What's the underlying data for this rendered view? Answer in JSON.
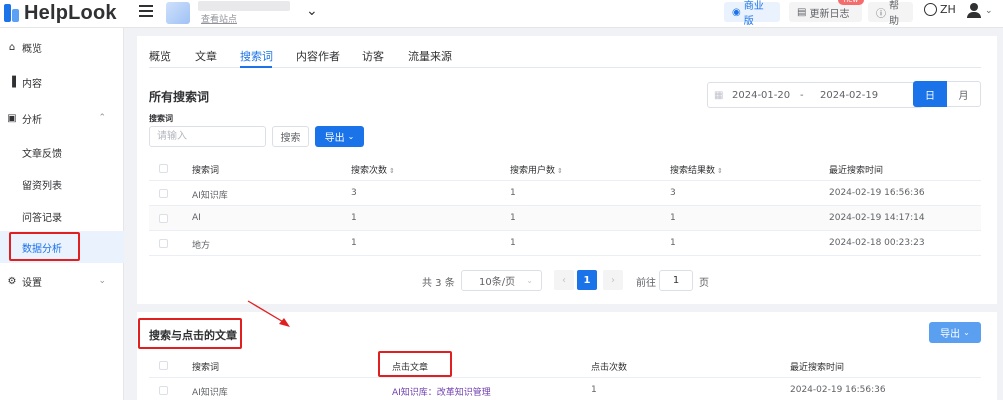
{
  "header": {
    "logo_text": "HelpLook",
    "site_link": "查看站点",
    "biz_label": "商业版",
    "changelog_label": "更新日志",
    "new_badge": "new",
    "help_label": "帮助",
    "lang_label": "ZH"
  },
  "sidebar": {
    "items": [
      {
        "label": "概览",
        "icon": "home-icon"
      },
      {
        "label": "内容",
        "icon": "bars-icon"
      },
      {
        "label": "分析",
        "icon": "chart-icon"
      },
      {
        "label": "设置",
        "icon": "gear-icon"
      }
    ],
    "sub_items": [
      "文章反馈",
      "留资列表",
      "问答记录",
      "数据分析"
    ]
  },
  "tabs": [
    "概览",
    "文章",
    "搜索词",
    "内容作者",
    "访客",
    "流量来源"
  ],
  "active_tab": "搜索词",
  "search_terms": {
    "title": "所有搜索词",
    "date_start": "2024-01-20",
    "date_sep": "-",
    "date_end": "2024-02-19",
    "granularity": [
      "日",
      "月"
    ],
    "filter_label": "搜索词",
    "input_placeholder": "请输入",
    "search_button": "搜索",
    "export_button": "导出",
    "columns": [
      "搜索词",
      "搜索次数",
      "搜索用户数",
      "搜索结果数",
      "最近搜索时间"
    ],
    "rows": [
      [
        "AI知识库",
        "3",
        "1",
        "3",
        "2024-02-19 16:56:36"
      ],
      [
        "AI",
        "1",
        "1",
        "1",
        "2024-02-19 14:17:14"
      ],
      [
        "地方",
        "1",
        "1",
        "1",
        "2024-02-18 00:23:23"
      ]
    ]
  },
  "pagination": {
    "total": "共 3 条",
    "page_size": "10条/页",
    "current_page": "1",
    "goto_label": "前往",
    "goto_value": "1",
    "page_suffix": "页"
  },
  "clicked_articles": {
    "title": "搜索与点击的文章",
    "export_button": "导出",
    "columns": [
      "搜索词",
      "点击文章",
      "点击次数",
      "最近搜索时间"
    ],
    "rows": [
      [
        "AI知识库",
        "AI知识库：改革知识管理",
        "1",
        "2024-02-19 16:56:36"
      ]
    ]
  },
  "colors": {
    "accent": "#1a73e8",
    "highlight_box": "#e02020",
    "link": "#6f3fb0"
  }
}
